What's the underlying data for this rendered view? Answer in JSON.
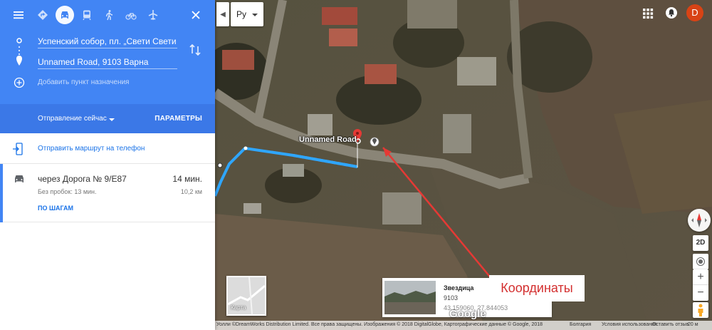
{
  "panel": {
    "modes": [
      {
        "name": "menu-icon",
        "active": false
      },
      {
        "name": "best-route-icon",
        "active": false
      },
      {
        "name": "car-icon",
        "active": true
      },
      {
        "name": "transit-icon",
        "active": false
      },
      {
        "name": "walking-icon",
        "active": false
      },
      {
        "name": "bicycle-icon",
        "active": false
      },
      {
        "name": "flight-icon",
        "active": false
      }
    ],
    "origin_value": "Успенский собор, пл. „Свети Свети К",
    "destination_value": "Unnamed Road, 9103 Варна",
    "add_destination": "Добавить пункт назначения",
    "departure": "Отправление сейчас",
    "params": "ПАРАМЕТРЫ",
    "send_to_phone": "Отправить маршрут на телефон",
    "route": {
      "via": "через Дорога № 9/E87",
      "time": "14 мин.",
      "traffic": "Без пробок: 13 мин.",
      "distance": "10,2 км",
      "steps": "ПО ШАГАМ"
    },
    "accent_color": "#4285f4"
  },
  "map": {
    "lang": "Ру",
    "avatar_letter": "D",
    "road_label": "Unnamed Road",
    "minimap_label": "Карта",
    "card": {
      "title": "Звездица",
      "zip": "9103",
      "coords": "43.159060, 27.844053"
    },
    "annotation": "Координаты",
    "btn_2d": "2D",
    "footer": {
      "attribution": "Уолли ©DreamWorks Distribution Limited. Все права защищены. Изображения © 2018 DigitalGlobe, Картографические данные © Google, 2018",
      "country": "Болгария",
      "terms": "Условия использования",
      "feedback": "Оставить отзыв",
      "scale": "20 м"
    },
    "google_logo": "Google"
  }
}
